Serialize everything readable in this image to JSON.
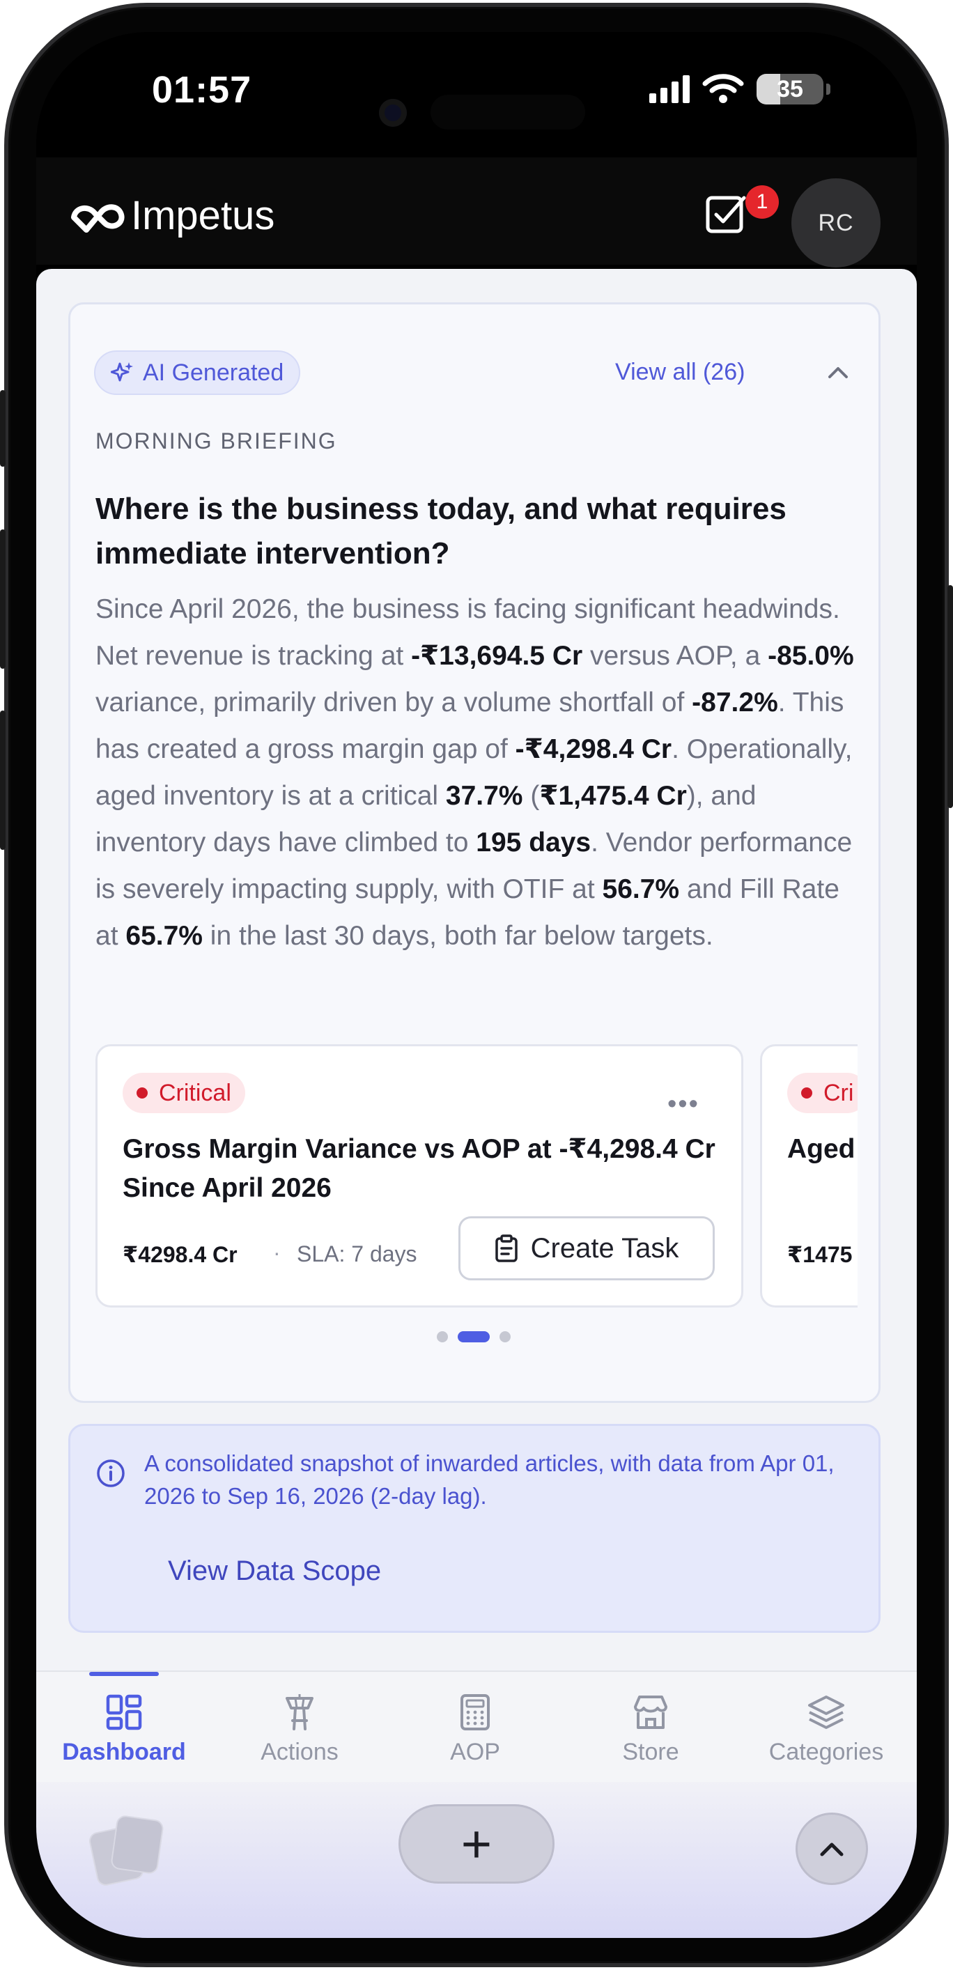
{
  "status_bar": {
    "time": "01:57",
    "battery": "35"
  },
  "header": {
    "app_name": "Impetus",
    "task_badge": "1",
    "avatar_initials": "RC"
  },
  "briefing": {
    "chip_label": "AI Generated",
    "view_all": "View all (26)",
    "eyebrow": "MORNING BRIEFING",
    "headline": "Where is the business today, and what requires immediate intervention?",
    "body": {
      "t1": "Since April 2026, the business is facing significant headwinds. Net revenue is tracking at ",
      "b1": "-₹13,694.5 Cr",
      "t2": " versus AOP, a ",
      "b2": "-85.0%",
      "t3": " variance, primarily driven by a volume shortfall of ",
      "b3": "-87.2%",
      "t4": ". This has created a gross margin gap of ",
      "b4": "-₹4,298.4 Cr",
      "t5": ". Operationally, aged inventory is at a critical ",
      "b5": "37.7%",
      "t6": " (",
      "b6": "₹1,475.4 Cr",
      "t7": "), and inventory days have climbed to ",
      "b7": "195 days",
      "t8": ". Vendor performance is severely impacting supply, with OTIF at ",
      "b8": "56.7%",
      "t9": " and Fill Rate at ",
      "b9": "65.7%",
      "t10": " in the last 30 days, both far below targets."
    },
    "cards": [
      {
        "severity": "Critical",
        "title": "Gross Margin Variance vs AOP at -₹4,298.4 Cr Since April 2026",
        "amount": "₹4298.4 Cr",
        "separator": "·",
        "sla": "SLA: 7 days",
        "action": "Create Task"
      },
      {
        "severity": "Cri",
        "title": "Aged Total",
        "amount": "₹1475"
      }
    ],
    "pager": {
      "count": 3,
      "active_index": 1
    }
  },
  "scope": {
    "text": "A consolidated snapshot of inwarded articles, with data from Apr 01, 2026 to Sep 16, 2026 (2-day lag).",
    "link": "View Data Scope"
  },
  "bottom_nav": [
    {
      "label": "Dashboard",
      "icon": "dashboard-grid-icon",
      "active": true
    },
    {
      "label": "Actions",
      "icon": "control-tower-icon",
      "active": false
    },
    {
      "label": "AOP",
      "icon": "calculator-icon",
      "active": false
    },
    {
      "label": "Store",
      "icon": "store-icon",
      "active": false
    },
    {
      "label": "Categories",
      "icon": "layers-icon",
      "active": false
    }
  ],
  "colors": {
    "accent": "#4f5ee3",
    "critical": "#d11b2b",
    "header_bg": "#0a0a0a",
    "badge": "#e5262c"
  }
}
